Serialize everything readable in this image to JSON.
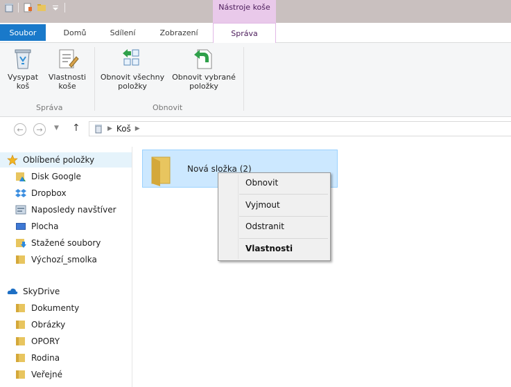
{
  "window": {
    "context_tab_header": "Nástroje koše"
  },
  "tabs": {
    "file": "Soubor",
    "home": "Domů",
    "share": "Sdílení",
    "view": "Zobrazení",
    "manage": "Správa"
  },
  "ribbon": {
    "empty_bin_line1": "Vysypat",
    "empty_bin_line2": "koš",
    "bin_props_line1": "Vlastnosti",
    "bin_props_line2": "koše",
    "restore_all_line1": "Obnovit všechny",
    "restore_all_line2": "položky",
    "restore_selected_line1": "Obnovit vybrané",
    "restore_selected_line2": "položky",
    "group_manage": "Správa",
    "group_restore": "Obnovit"
  },
  "address": {
    "path_item": "Koš"
  },
  "nav": {
    "favorites": "Oblíbené položky",
    "disk_google": "Disk Google",
    "dropbox": "Dropbox",
    "recent": "Naposledy navštíver",
    "desktop": "Plocha",
    "downloads": "Stažené soubory",
    "default_smolka": "Výchozí_smolka",
    "skydrive": "SkyDrive",
    "documents": "Dokumenty",
    "pictures": "Obrázky",
    "opory": "OPORY",
    "family": "Rodina",
    "public": "Veřejné"
  },
  "content": {
    "item_name": "Nová složka (2)"
  },
  "context_menu": {
    "restore": "Obnovit",
    "cut": "Vyjmout",
    "delete": "Odstranit",
    "properties": "Vlastnosti"
  },
  "colors": {
    "file_tab": "#1979ca",
    "context_tab": "#e9c9ea",
    "selection": "#cce8ff",
    "titlebar": "#c9c0bf"
  }
}
